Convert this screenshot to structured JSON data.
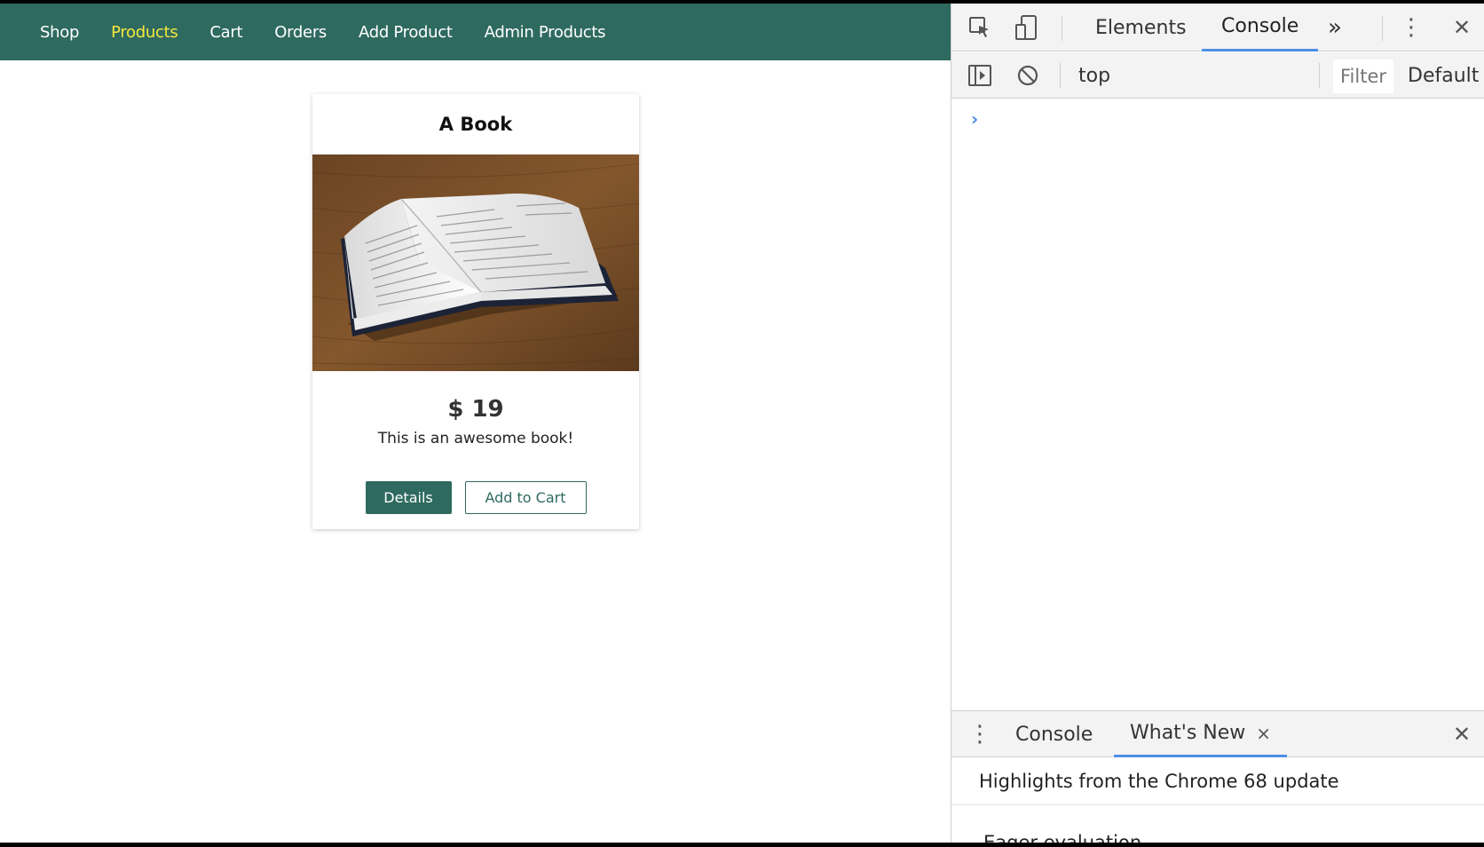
{
  "nav": {
    "items": [
      {
        "label": "Shop",
        "active": false
      },
      {
        "label": "Products",
        "active": true
      },
      {
        "label": "Cart",
        "active": false
      },
      {
        "label": "Orders",
        "active": false
      },
      {
        "label": "Add Product",
        "active": false
      },
      {
        "label": "Admin Products",
        "active": false
      }
    ]
  },
  "product": {
    "title": "A Book",
    "price": "$ 19",
    "description": "This is an awesome book!",
    "details_label": "Details",
    "add_to_cart_label": "Add to Cart"
  },
  "devtools": {
    "tabs": {
      "elements": "Elements",
      "console": "Console",
      "more": "»"
    },
    "toolbar": {
      "context": "top",
      "filter_placeholder": "Filter",
      "levels": "Default l"
    },
    "console_prompt": "›",
    "drawer": {
      "tab_console": "Console",
      "tab_whats_new": "What's New",
      "close_tab_glyph": "×",
      "close_drawer_glyph": "✕",
      "highlight": "Highlights from the Chrome 68 update",
      "next_heading": "Eager evaluation"
    }
  },
  "colors": {
    "brand": "#2e6a60",
    "nav_active": "#f5e83d",
    "devtools_accent": "#4c8ee6"
  }
}
